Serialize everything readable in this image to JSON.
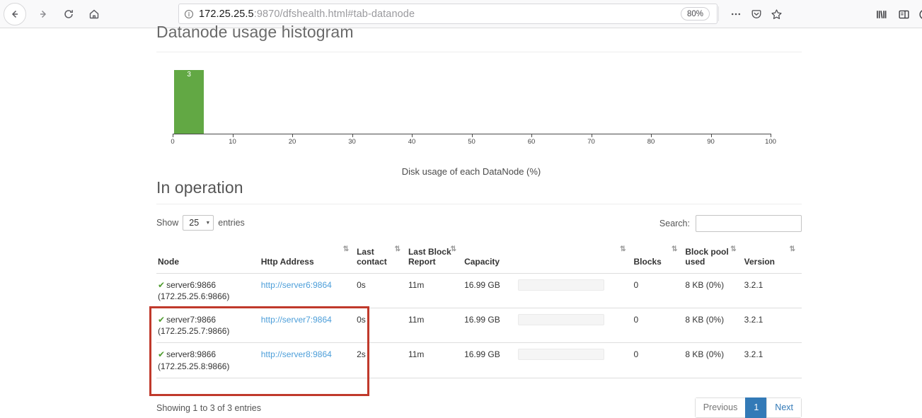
{
  "browser": {
    "back_icon": "back-arrow-icon",
    "forward_icon": "forward-arrow-icon",
    "reload_icon": "reload-icon",
    "home_icon": "home-icon",
    "url_host": "172.25.25.5",
    "url_rest": ":9870/dfshealth.html#tab-datanode",
    "zoom_level": "80%",
    "info_icon": "page-info-icon",
    "page_actions_icon": "ellipsis-icon",
    "pocket_icon": "pocket-icon",
    "bookmark_icon": "star-icon",
    "library_icon": "library-icon",
    "sidebar_icon": "sidebar-icon"
  },
  "histogram": {
    "title": "Datanode usage histogram"
  },
  "chart_data": {
    "type": "bar",
    "title": "Datanode usage histogram",
    "xlabel": "Disk usage of each DataNode (%)",
    "ylabel": "",
    "xlim": [
      0,
      100
    ],
    "ylim": [
      0,
      3
    ],
    "grid": false,
    "bin_width": 5,
    "categories": [
      "0-5"
    ],
    "values": [
      3
    ],
    "data_labels": [
      "3"
    ],
    "bar_color": "#62a844",
    "tick_labels": [
      "0",
      "10",
      "20",
      "30",
      "40",
      "50",
      "60",
      "70",
      "80",
      "90",
      "100"
    ],
    "ticks": [
      0,
      10,
      20,
      30,
      40,
      50,
      60,
      70,
      80,
      90,
      100
    ]
  },
  "in_operation": {
    "title": "In operation",
    "show_label": "Show",
    "entries_value": "25",
    "entries_label": "entries",
    "caret_icon": "chevron-down-icon",
    "search_label": "Search:",
    "search_value": "",
    "search_placeholder": "",
    "columns": [
      "Node",
      "Http Address",
      "Last contact",
      "Last Block Report",
      "Capacity",
      "Blocks",
      "Block pool used",
      "Version"
    ],
    "sort_icon": "sort-updown-icon",
    "rows": [
      {
        "status_icon": "check-icon",
        "node": "server6:9866",
        "node_address": "(172.25.25.6:9866)",
        "http_address": "http://server6:9864",
        "last_contact": "0s",
        "last_block_report": "11m",
        "capacity": "16.99 GB",
        "capacity_pct": 8,
        "blocks": "0",
        "block_pool_used": "8 KB (0%)",
        "version": "3.2.1"
      },
      {
        "status_icon": "check-icon",
        "node": "server7:9866",
        "node_address": "(172.25.25.7:9866)",
        "http_address": "http://server7:9864",
        "last_contact": "0s",
        "last_block_report": "11m",
        "capacity": "16.99 GB",
        "capacity_pct": 8,
        "blocks": "0",
        "block_pool_used": "8 KB (0%)",
        "version": "3.2.1"
      },
      {
        "status_icon": "check-icon",
        "node": "server8:9866",
        "node_address": "(172.25.25.8:9866)",
        "http_address": "http://server8:9864",
        "last_contact": "2s",
        "last_block_report": "11m",
        "capacity": "16.99 GB",
        "capacity_pct": 8,
        "blocks": "0",
        "block_pool_used": "8 KB (0%)",
        "version": "3.2.1"
      }
    ],
    "showing_info": "Showing 1 to 3 of 3 entries",
    "pagination": {
      "previous": "Previous",
      "pages": [
        "1"
      ],
      "next": "Next",
      "active_page": "1"
    }
  },
  "colors": {
    "accent_blue": "#337ab7",
    "link_blue": "#4c9ed9",
    "bar_green": "#62a844",
    "progress_green": "#5cb85c",
    "annotation_red": "#c0392b"
  }
}
